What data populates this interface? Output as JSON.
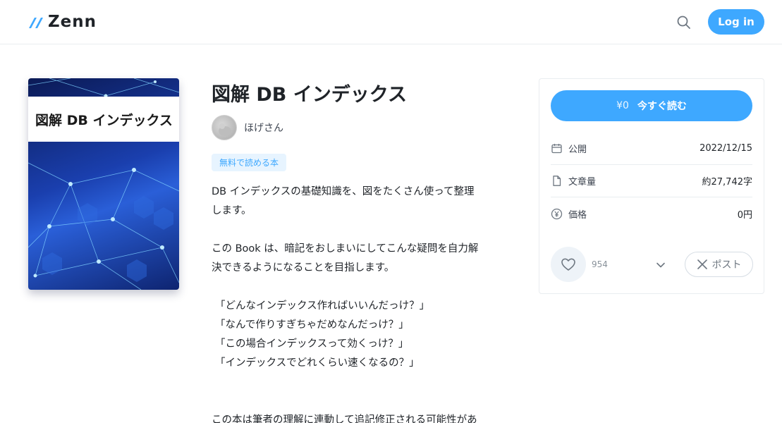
{
  "header": {
    "logo_text": "Zenn",
    "login_label": "Log in",
    "search_icon": "search-icon",
    "accent_color": "#3ea8ff"
  },
  "cover": {
    "title": "図解 DB インデックス"
  },
  "book": {
    "title": "図解 DB インデックス",
    "author_name": "ほげさん",
    "badge": "無料で読める本",
    "description": [
      "DB インデックスの基礎知識を、図をたくさん使って整理\nします。",
      "この Book は、暗記をおしまいにしてこんな疑問を自力解\n決できるようになることを目指します。",
      "「どんなインデックス作ればいいんだっけ？」\n「なんで作りすぎちゃだめなんだっけ？」\n「この場合インデックスって効くっけ？」\n「インデックスでどれくらい速くなるの？」",
      "この本は筆者の理解に連動して追記修正される可能性があ"
    ]
  },
  "sidebar": {
    "read_price": "¥0",
    "read_label": "今すぐ読む",
    "meta": [
      {
        "icon": "calendar-icon",
        "label": "公開",
        "value": "2022/12/15"
      },
      {
        "icon": "document-icon",
        "label": "文章量",
        "value": "約27,742字"
      },
      {
        "icon": "yen-icon",
        "label": "価格",
        "value": "0円"
      }
    ],
    "like_count": "954",
    "post_label": "ポスト"
  }
}
